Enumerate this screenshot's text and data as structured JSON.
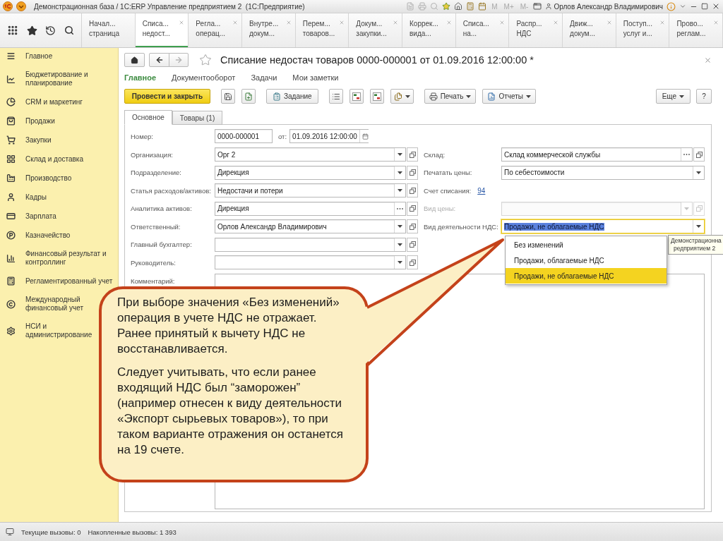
{
  "window": {
    "title": "Демонстрационная база / 1С:ERP Управление предприятием 2  (1С:Предприятие)",
    "memory_buttons": [
      "M",
      "M+",
      "M-"
    ],
    "user": "Орлов Александр Владимирович"
  },
  "open_tabs": [
    {
      "lines": [
        "Начал...",
        "страница"
      ],
      "selected": false,
      "closable": false
    },
    {
      "lines": [
        "Списа...",
        "недост..."
      ],
      "selected": true,
      "closable": true
    },
    {
      "lines": [
        "Регла...",
        "операц..."
      ],
      "selected": false,
      "closable": true
    },
    {
      "lines": [
        "Внутре...",
        "докум..."
      ],
      "selected": false,
      "closable": true
    },
    {
      "lines": [
        "Перем...",
        "товаров..."
      ],
      "selected": false,
      "closable": true
    },
    {
      "lines": [
        "Докум...",
        "закупки..."
      ],
      "selected": false,
      "closable": true
    },
    {
      "lines": [
        "Коррек...",
        "вида..."
      ],
      "selected": false,
      "closable": true
    },
    {
      "lines": [
        "Списа...",
        "на..."
      ],
      "selected": false,
      "closable": true
    },
    {
      "lines": [
        "Распр...",
        "НДС"
      ],
      "selected": false,
      "closable": true
    },
    {
      "lines": [
        "Движ...",
        "докум..."
      ],
      "selected": false,
      "closable": true
    },
    {
      "lines": [
        "Поступ...",
        "услуг и..."
      ],
      "selected": false,
      "closable": true
    },
    {
      "lines": [
        "Прово...",
        "реглам..."
      ],
      "selected": false,
      "closable": true
    }
  ],
  "sections": [
    {
      "lines": [
        "Главное"
      ]
    },
    {
      "lines": [
        "Бюджетирование и",
        "планирование"
      ]
    },
    {
      "lines": [
        "CRM и маркетинг"
      ]
    },
    {
      "lines": [
        "Продажи"
      ]
    },
    {
      "lines": [
        "Закупки"
      ]
    },
    {
      "lines": [
        "Склад и доставка"
      ]
    },
    {
      "lines": [
        "Производство"
      ]
    },
    {
      "lines": [
        "Кадры"
      ]
    },
    {
      "lines": [
        "Зарплата"
      ]
    },
    {
      "lines": [
        "Казначейство"
      ]
    },
    {
      "lines": [
        "Финансовый результат и",
        "контроллинг"
      ]
    },
    {
      "lines": [
        "Регламентированный учет"
      ]
    },
    {
      "lines": [
        "Международный",
        "финансовый учет"
      ]
    },
    {
      "lines": [
        "НСИ и",
        "администрирование"
      ]
    }
  ],
  "form": {
    "title": "Списание недостач товаров 0000-000001 от 01.09.2016 12:00:00 *",
    "favorite": false,
    "can_go_forward": false,
    "nav": [
      {
        "label": "Главное",
        "selected": true
      },
      {
        "label": "Документооборот",
        "selected": false
      },
      {
        "label": "Задачи",
        "selected": false
      },
      {
        "label": "Мои заметки",
        "selected": false
      }
    ],
    "command_groups": [
      [
        {
          "kind": "primary",
          "label": "Провести и закрыть"
        }
      ],
      [
        {
          "kind": "icon"
        },
        {
          "kind": "icon"
        }
      ],
      [
        {
          "kind": "labeled",
          "label": "Задание"
        }
      ],
      [
        {
          "kind": "icon"
        },
        {
          "kind": "icon"
        },
        {
          "kind": "icon"
        },
        {
          "kind": "icon_menu"
        }
      ],
      [
        {
          "kind": "menu",
          "label": "Печать"
        },
        {
          "kind": "menu",
          "label": "Отчеты"
        }
      ]
    ],
    "more": "Еще",
    "help": "?",
    "tabs": [
      {
        "label": "Основное",
        "selected": true
      },
      {
        "label": "Товары (1)",
        "selected": false
      }
    ],
    "number": {
      "label": "Номер:",
      "value": "0000-000001",
      "date_label": "от:",
      "date": "01.09.2016 12:00:00"
    },
    "left_fields": [
      {
        "label": "Организация:",
        "value": "Орг 2",
        "kind": "dropdown",
        "disabled": false,
        "focused": false
      },
      {
        "label": "Подразделение:",
        "value": "Дирекция",
        "kind": "dropdown",
        "disabled": false,
        "focused": false
      },
      {
        "label": "Статья расходов/активов:",
        "value": "Недостачи и потери",
        "kind": "dropdown",
        "disabled": false,
        "focused": false
      },
      {
        "label": "Аналитика активов:",
        "value": "Дирекция",
        "kind": "choice",
        "disabled": false,
        "focused": false
      },
      {
        "label": "Ответственный:",
        "value": "Орлов Александр Владимирович",
        "kind": "dropdown",
        "disabled": false,
        "focused": false
      },
      {
        "label": "Главный бухгалтер:",
        "kind": "dropdown",
        "disabled": false,
        "focused": false
      },
      {
        "label": "Руководитель:",
        "kind": "dropdown",
        "disabled": false,
        "focused": false
      }
    ],
    "right_fields": [
      {
        "label": "Склад:",
        "value": "Склад коммерческой службы",
        "kind": "choice",
        "disabled": false,
        "focused": false
      },
      {
        "label": "Печатать цены:",
        "value": "По себестоимости",
        "kind": "select",
        "disabled": false,
        "focused": false
      },
      {
        "label": "Счет списания:",
        "value": "94",
        "kind": "link",
        "disabled": false,
        "focused": false
      },
      {
        "label": "Вид цены:",
        "kind": "dropdown",
        "disabled": true,
        "focused": false
      },
      {
        "label": "Вид деятельности НДС:",
        "value": "Продажи, не облагаемые НДС",
        "kind": "select",
        "disabled": false,
        "focused": true,
        "options": [
          {
            "label": "Без изменений",
            "selected": false
          },
          {
            "label": "Продажи, облагаемые НДС",
            "selected": false
          },
          {
            "label": "Продажи, не облагаемые НДС",
            "selected": true
          }
        ]
      }
    ],
    "comment": {
      "label": "Комментарий:"
    }
  },
  "callout": {
    "paragraphs": [
      "При выборе значения «Без изменений» операция в учете НДС не отражает. Ранее принятый к вычету НДС не восстанавливается.",
      "Следует учитывать, что если ранее входящий НДС был “заморожен” (например отнесен к виду деятельности «Экспорт сырьевых товаров»), то при таком варианте отражения он останется на 19 счете."
    ]
  },
  "tooltip": {
    "lines": [
      "Демонстрационна",
      "редприятием 2"
    ]
  },
  "status_bar": {
    "current": "Текущие вызовы: 0",
    "accumulated": "Накопленные вызовы: 1 393"
  }
}
